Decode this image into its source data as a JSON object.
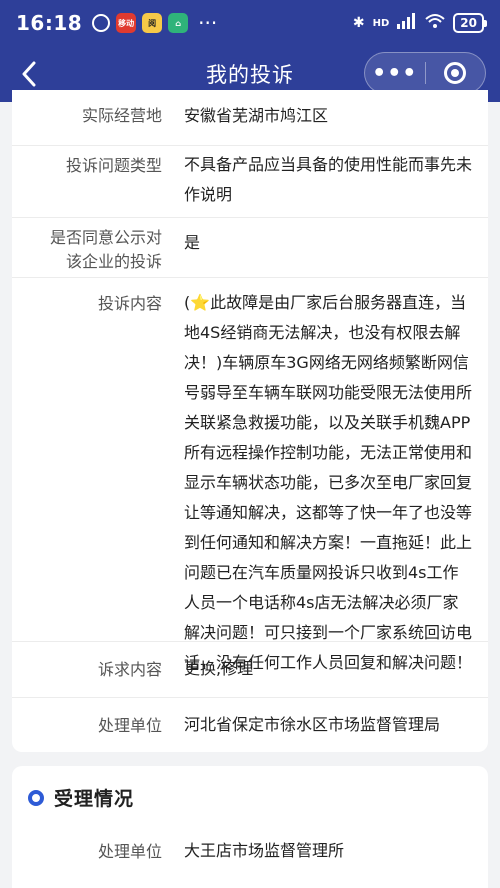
{
  "status_bar": {
    "time": "16:18",
    "apps": [
      "alarm-icon",
      "bank-app-icon",
      "app-icon",
      "home-app-icon"
    ],
    "app_labels": [
      "",
      "移动",
      "阅",
      ""
    ],
    "more": "···",
    "network": "HD",
    "battery": "20"
  },
  "nav": {
    "title": "我的投诉",
    "back_icon": "chevron-left-icon",
    "more_label": "•••",
    "close_icon": "target-icon"
  },
  "details": {
    "operating_location": {
      "label": "实际经营地",
      "value": "安徽省芜湖市鸠江区"
    },
    "complaint_type": {
      "label": "投诉问题类型",
      "value": "不具备产品应当具备的使用性能而事先未作说明"
    },
    "public_consent": {
      "label_line1": "是否同意公示对",
      "label_line2": "该企业的投诉",
      "value": "是"
    },
    "complaint_content": {
      "label": "投诉内容",
      "value": "(⭐此故障是由厂家后台服务器直连，当地4S经销商无法解决，也没有权限去解决！)车辆原车3G网络无网络频繁断网信号弱导至车辆车联网功能受限无法使用所关联紧急救援功能，以及关联手机魏APP所有远程操作控制功能，无法正常使用和显示车辆状态功能，已多次至电厂家回复让等通知解决，这都等了快一年了也没等到任何通知和解决方案！一直拖延！此上问题已在汽车质量网投诉只收到4s工作人员一个电话称4s店无法解决必须厂家解决问题！可只接到一个厂家系统回访电话，没有任何工作人员回复和解决问题！"
    },
    "demand": {
      "label": "诉求内容",
      "value": "更换,修理"
    },
    "handling_unit": {
      "label": "处理单位",
      "value": "河北省保定市徐水区市场监督管理局"
    }
  },
  "acceptance": {
    "title": "受理情况",
    "handling_unit": {
      "label": "处理单位",
      "value": "大王店市场监督管理所"
    }
  },
  "colors": {
    "accent": "#2e3f99",
    "dot": "#2e5bd6",
    "background": "#f2f3f5"
  }
}
